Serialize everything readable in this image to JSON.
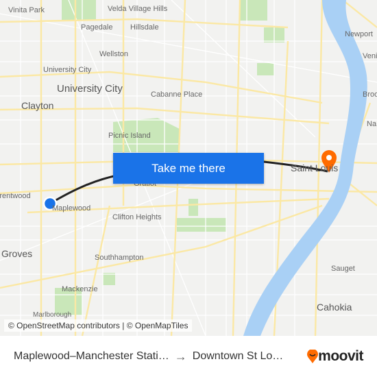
{
  "map": {
    "labels": [
      "Vinita Park",
      "Velda Village Hills",
      "Pagedale",
      "Hillsdale",
      "Wellston",
      "University City",
      "University City",
      "Clayton",
      "Cabanne Place",
      "Picnic Island",
      "Brentwood",
      "Maplewood",
      "Gratiot",
      "Clifton Heights",
      "Groves",
      "Southhampton",
      "Mackenzie",
      "Marlborough",
      "Saint Louis",
      "Newport",
      "Venice",
      "Brooklyn",
      "Na",
      "Sauget",
      "Cahokia"
    ],
    "colors": {
      "land": "#f2f2f0",
      "water": "#a9d0f5",
      "park": "#c9e7b9",
      "road": "#fbe8a4",
      "route": "#222222",
      "origin": "#1a73e8",
      "destination": "#ff6b00"
    },
    "origin_icon": "blue-dot-icon",
    "destination_icon": "map-pin-icon"
  },
  "cta": {
    "label": "Take me there"
  },
  "attribution": "© OpenStreetMap contributors | © OpenMapTiles",
  "footer": {
    "origin": "Maplewood–Manchester Stati…",
    "arrow": "→",
    "destination": "Downtown St Lo…",
    "brand": "moovit"
  }
}
